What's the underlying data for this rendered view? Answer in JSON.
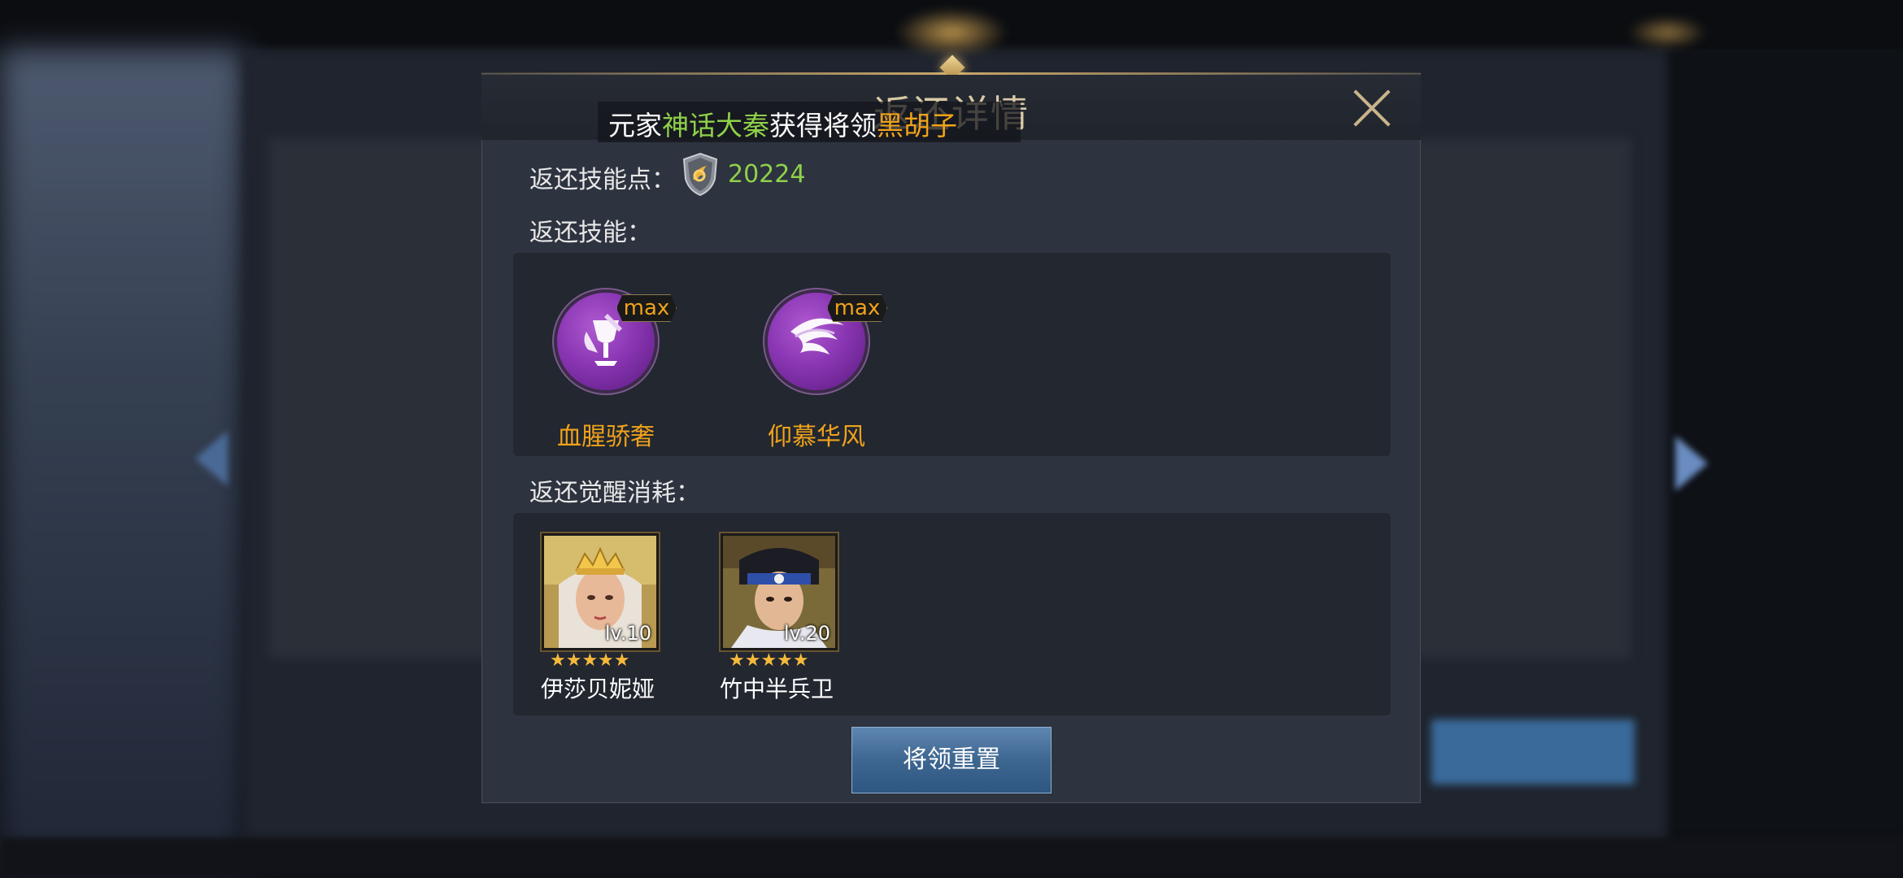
{
  "dialog": {
    "title": "返还详情",
    "close_icon": "close-icon"
  },
  "marquee": {
    "prefix": "元家",
    "player": "神话大秦",
    "middle": "获得将领",
    "general": "黑胡子"
  },
  "returned_points": {
    "label": "返还技能点：",
    "icon": "skill-point-shield-icon",
    "value": "20224"
  },
  "returned_skills": {
    "label": "返还技能：",
    "items": [
      {
        "name": "血腥骄奢",
        "badge": "max",
        "icon": "goblet-skill-icon"
      },
      {
        "name": "仰慕华风",
        "badge": "max",
        "icon": "whirlwind-skill-icon"
      }
    ]
  },
  "returned_awakening": {
    "label": "返还觉醒消耗：",
    "heroes": [
      {
        "name": "伊莎贝妮娅",
        "level": "lv.10",
        "stars": "★★★★★",
        "star_count": 5
      },
      {
        "name": "竹中半兵卫",
        "level": "lv.20",
        "stars": "★★★★★",
        "star_count": 5
      }
    ]
  },
  "actions": {
    "reset_label": "将领重置"
  },
  "colors": {
    "accent_green": "#8fd14a",
    "accent_orange": "#f0a21a",
    "title_gold": "#d9c9a6"
  }
}
